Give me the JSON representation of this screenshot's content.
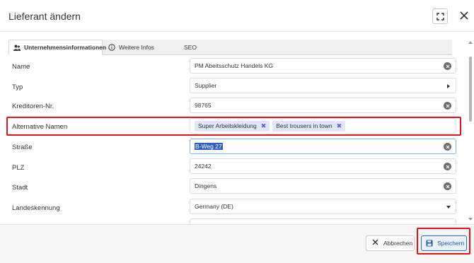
{
  "dialog": {
    "title": "Lieferant ändern"
  },
  "tabs": [
    {
      "label": "Unternehmensinformationen",
      "icon": "users-icon",
      "active": true
    },
    {
      "label": "Weitere Infos",
      "icon": "info-icon",
      "active": false
    },
    {
      "label": "SEO",
      "icon": "",
      "active": false
    }
  ],
  "fields": {
    "name": {
      "label": "Name",
      "value": "PM Abeitsschutz Handels KG"
    },
    "typ": {
      "label": "Typ",
      "value": "Supplier"
    },
    "kreditoren": {
      "label": "Kreditoren-Nr.",
      "value": "98765"
    },
    "alt_namen": {
      "label": "Alternative Namen",
      "chips": [
        "Super Arbeitskleidung",
        "Best trousers in town"
      ]
    },
    "strasse": {
      "label": "Straße",
      "value": "B-Weg 27"
    },
    "plz": {
      "label": "PLZ",
      "value": "24242"
    },
    "stadt": {
      "label": "Stadt",
      "value": "Dingens"
    },
    "land": {
      "label": "Landeskennung",
      "value": "Germany (DE)"
    }
  },
  "footer": {
    "cancel_label": "Abbrechen",
    "save_label": "Speichern"
  },
  "colors": {
    "highlight": "#e0141f",
    "chip_bg": "#dfe6f7",
    "save_border": "#2d6fbf",
    "selection": "#2e5fbf"
  }
}
